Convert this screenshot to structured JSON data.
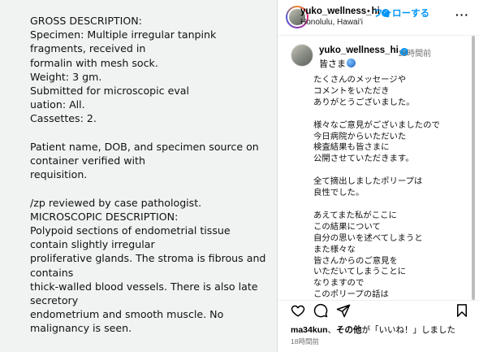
{
  "document": {
    "text": "GROSS DESCRIPTION:\nSpecimen: Multiple irregular tanpink fragments, received in\nformalin with mesh sock.\nWeight: 3 gm.\nSubmitted for microscopic eval\nuation: All.\nCassettes: 2.\n\nPatient name, DOB, and specimen source on container verified with\nrequisition.\n\n/zp reviewed by case pathologist.\nMICROSCOPIC DESCRIPTION:\nPolypoid sections of endometrial tissue contain slightly irregular\nproliferative glands. The stroma is fibrous and contains\nthick-walled blood vessels. There is also late secretory\nendometrium and smooth muscle. No malignancy is seen."
  },
  "header": {
    "username": "yuko_wellness_hi",
    "separator": "•",
    "follow_label": "フォローする",
    "location": "Honolulu, Hawai'i",
    "more_icon": "more-horizontal-icon"
  },
  "caption": {
    "username": "yuko_wellness_hi",
    "time": "18時間前",
    "greeting": "皆さま",
    "body": "たくさんのメッセージや\nコメントをいただき\nありがとうございました。\n\n様々なご意見がございましたので\n今日病院からいただいた\n検査結果も皆さまに\n公開させていただきます。\n\n全て摘出しましたポリープは\n良性でした。\n\nあえてまた私がここに\nこの結果について\n自分の思いを述べてしまうと\nまた様々な\n皆さんからのご意見を\nいただいてしまうことに\nなりますので\nこのポリープの話は\nこの検査結果を"
  },
  "actions": {
    "icons": [
      "heart-icon",
      "comment-icon",
      "share-icon",
      "bookmark-icon"
    ]
  },
  "likes": {
    "user": "ma34kun",
    "middle": "、",
    "others": "その他",
    "suffix": "が「いいね！」しました"
  },
  "post_time": "18時間前",
  "colors": {
    "accent": "#0095f6",
    "muted": "#737373"
  }
}
